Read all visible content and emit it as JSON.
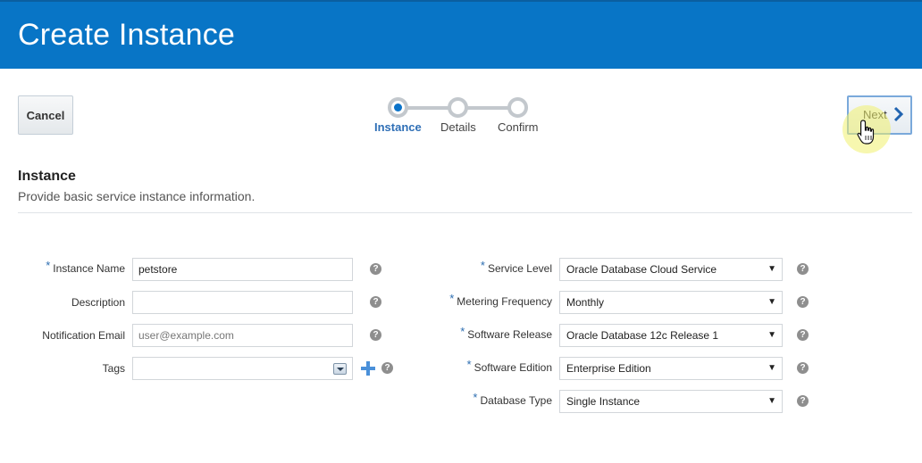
{
  "header": {
    "title": "Create Instance"
  },
  "toolbar": {
    "cancel_label": "Cancel",
    "next_label": "Next"
  },
  "train": {
    "steps": [
      {
        "label": "Instance",
        "active": true
      },
      {
        "label": "Details",
        "active": false
      },
      {
        "label": "Confirm",
        "active": false
      }
    ]
  },
  "section": {
    "title": "Instance",
    "description": "Provide basic service instance information."
  },
  "left_form": {
    "instance_name": {
      "label": "Instance Name",
      "required": "*",
      "value": "petstore"
    },
    "description": {
      "label": "Description",
      "value": ""
    },
    "notification_email": {
      "label": "Notification Email",
      "placeholder": "user@example.com"
    },
    "tags": {
      "label": "Tags",
      "value": ""
    }
  },
  "right_form": {
    "service_level": {
      "label": "Service Level",
      "required": "*",
      "value": "Oracle Database Cloud Service"
    },
    "metering_frequency": {
      "label": "Metering Frequency",
      "required": "*",
      "value": "Monthly"
    },
    "software_release": {
      "label": "Software Release",
      "required": "*",
      "value": "Oracle Database 12c Release 1"
    },
    "software_edition": {
      "label": "Software Edition",
      "required": "*",
      "value": "Enterprise Edition"
    },
    "database_type": {
      "label": "Database Type",
      "required": "*",
      "value": "Single Instance"
    }
  },
  "icons": {
    "help": "help-icon",
    "add": "plus-icon",
    "next": "chevron-right-icon",
    "cursor": "hand-pointer-icon"
  },
  "colors": {
    "header_bg": "#0875c6",
    "accent": "#0b73c9",
    "required": "#2b6cb0",
    "plus": "#4a90d9"
  },
  "glyphs": {
    "help": "?",
    "arrow": "▼"
  }
}
